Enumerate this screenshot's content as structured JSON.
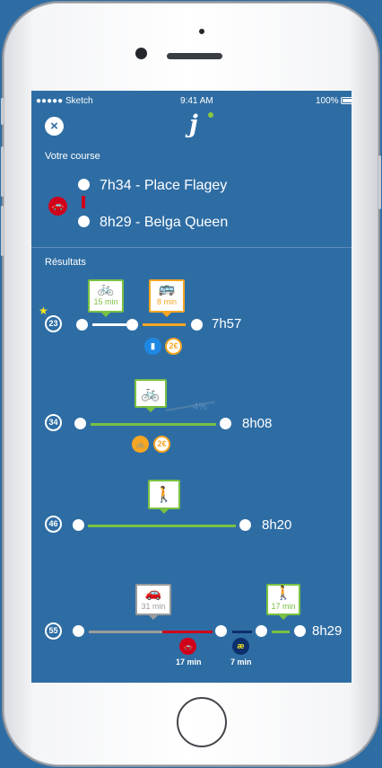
{
  "status": {
    "carrier": "●●●●● Sketch",
    "time": "9:41 AM",
    "battery": "100%"
  },
  "header": {
    "close_icon": "×",
    "logo": "j"
  },
  "course": {
    "title": "Votre course",
    "from": "7h34 - Place Flagey",
    "to": "8h29 - Belga Queen",
    "mode_icon": "car-icon"
  },
  "results": {
    "title": "Résultats",
    "items": [
      {
        "duration": "23",
        "favorite": "★",
        "arrival": "7h57",
        "cards": [
          {
            "icon": "bike-icon",
            "glyph": "🚲",
            "label": "15 min",
            "color": "#7ac143"
          },
          {
            "icon": "bus-icon",
            "glyph": "🚌",
            "label": "8 min",
            "color": "#f5a623"
          }
        ],
        "badges": [
          {
            "icon": "ticket-icon",
            "text": "▮",
            "color": "#1e88e5"
          },
          {
            "icon": "price-icon",
            "text": "2€",
            "color": "#f5a623"
          }
        ]
      },
      {
        "duration": "34",
        "arrival": "8h08",
        "elevation": "4%",
        "cards": [
          {
            "icon": "bike-icon",
            "glyph": "🚲",
            "label": "",
            "color": "#7ac143"
          }
        ],
        "badges": [
          {
            "icon": "bike-share-icon",
            "text": "🚲",
            "color": "#f5a623"
          },
          {
            "icon": "price-icon",
            "text": "2€",
            "color": "#f5a623"
          }
        ]
      },
      {
        "duration": "46",
        "arrival": "8h20",
        "cards": [
          {
            "icon": "walk-icon",
            "glyph": "🚶",
            "label": "",
            "color": "#7ac143"
          }
        ]
      },
      {
        "duration": "55",
        "arrival": "8h29",
        "cards": [
          {
            "icon": "car-icon",
            "glyph": "🚗",
            "label": "31 min",
            "color": "#9b9b9b"
          },
          {
            "icon": "walk-icon",
            "glyph": "🚶",
            "label": "17 min",
            "color": "#7ac143"
          }
        ],
        "badges": [
          {
            "icon": "traffic-icon",
            "text": "🚗",
            "color": "#d0021b",
            "label": "17 min"
          },
          {
            "icon": "metro-icon",
            "text": "æ",
            "color": "#0d2f6b",
            "label": "7 min"
          }
        ]
      }
    ]
  },
  "colors": {
    "background": "#2e6da4",
    "green": "#7ac143",
    "orange": "#f5a623",
    "red": "#d0021b",
    "grey": "#9b9b9b",
    "navy": "#0d2f6b"
  }
}
